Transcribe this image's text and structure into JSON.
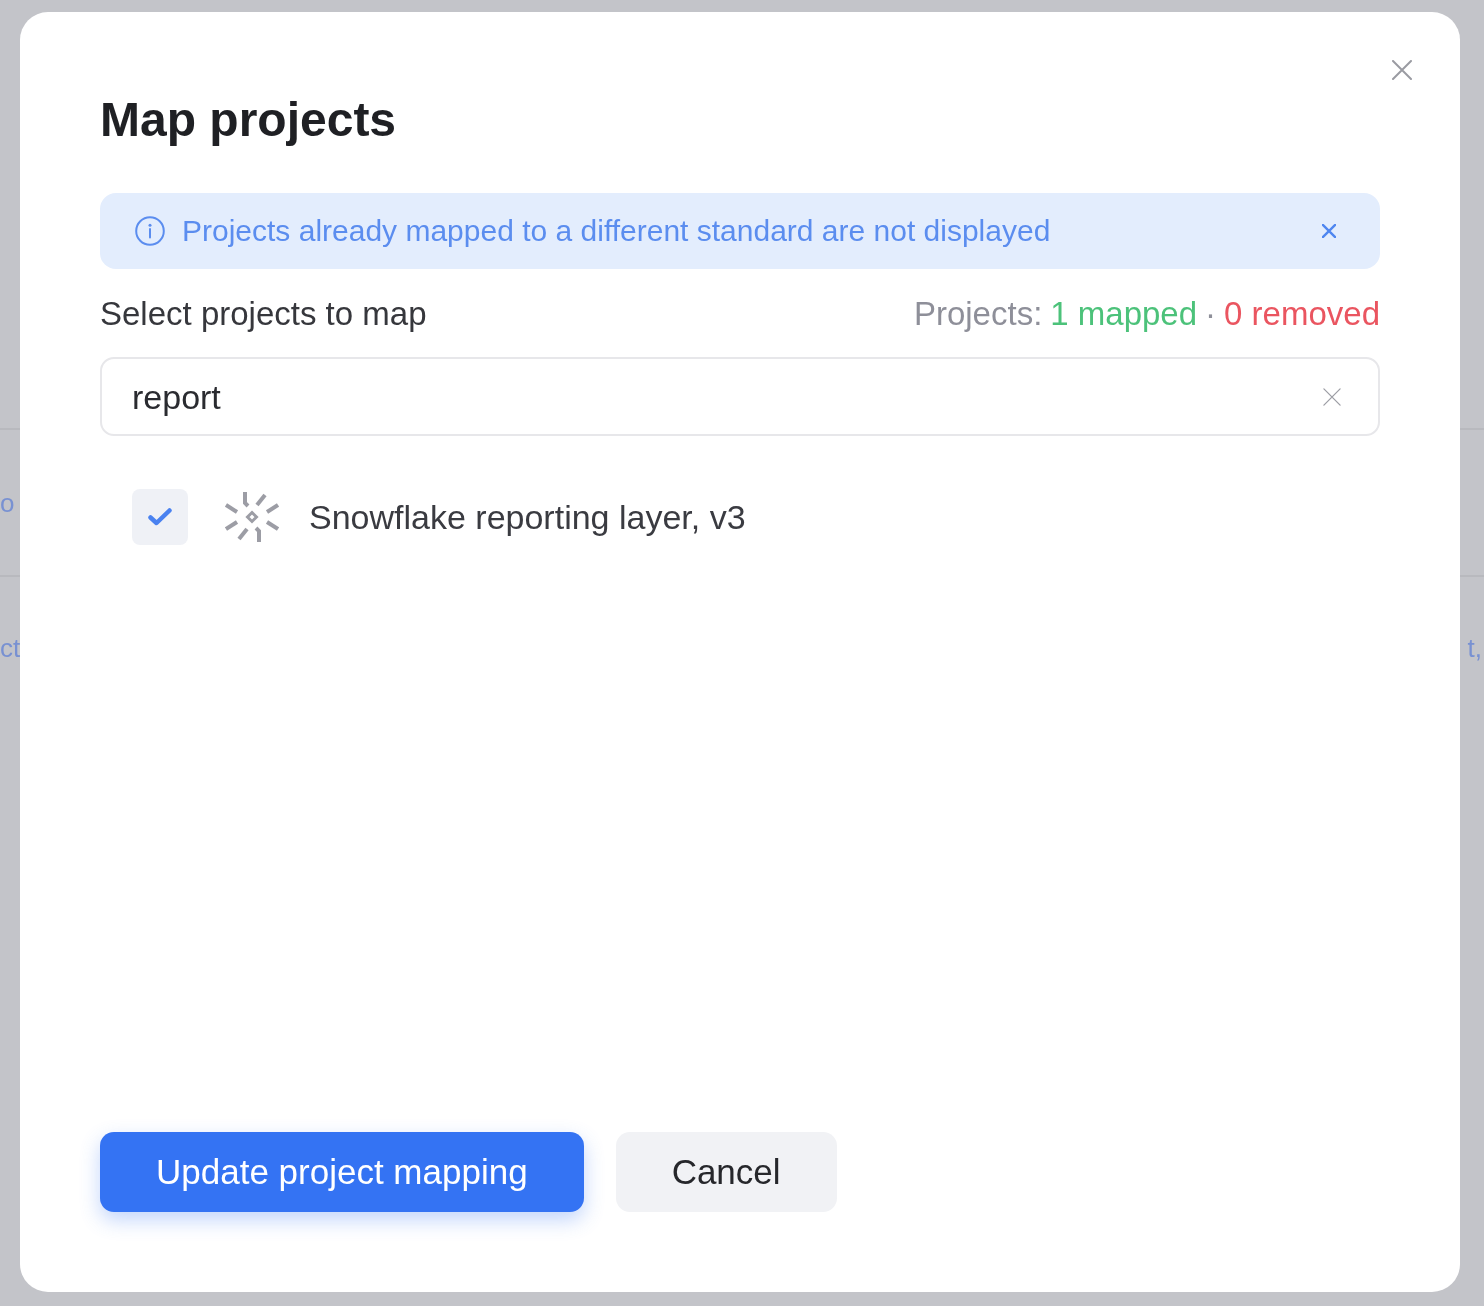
{
  "background": {
    "rows": [
      {
        "start": "o"
      },
      {
        "start": "ct",
        "end": "t,"
      }
    ]
  },
  "dialog": {
    "title": "Map projects"
  },
  "notice": {
    "text": "Projects already mapped to a different standard are not displayed"
  },
  "selection": {
    "label": "Select projects to map",
    "summary": {
      "prefix": "Projects:",
      "mapped": "1 mapped",
      "separator": "·",
      "removed": "0 removed"
    }
  },
  "search": {
    "value": "report"
  },
  "projects": [
    {
      "name": "Snowflake reporting layer, v3",
      "checked": true
    }
  ],
  "buttons": [
    {
      "label": "Update project mapping",
      "kind": "primary"
    },
    {
      "label": "Cancel",
      "kind": "secondary"
    }
  ]
}
